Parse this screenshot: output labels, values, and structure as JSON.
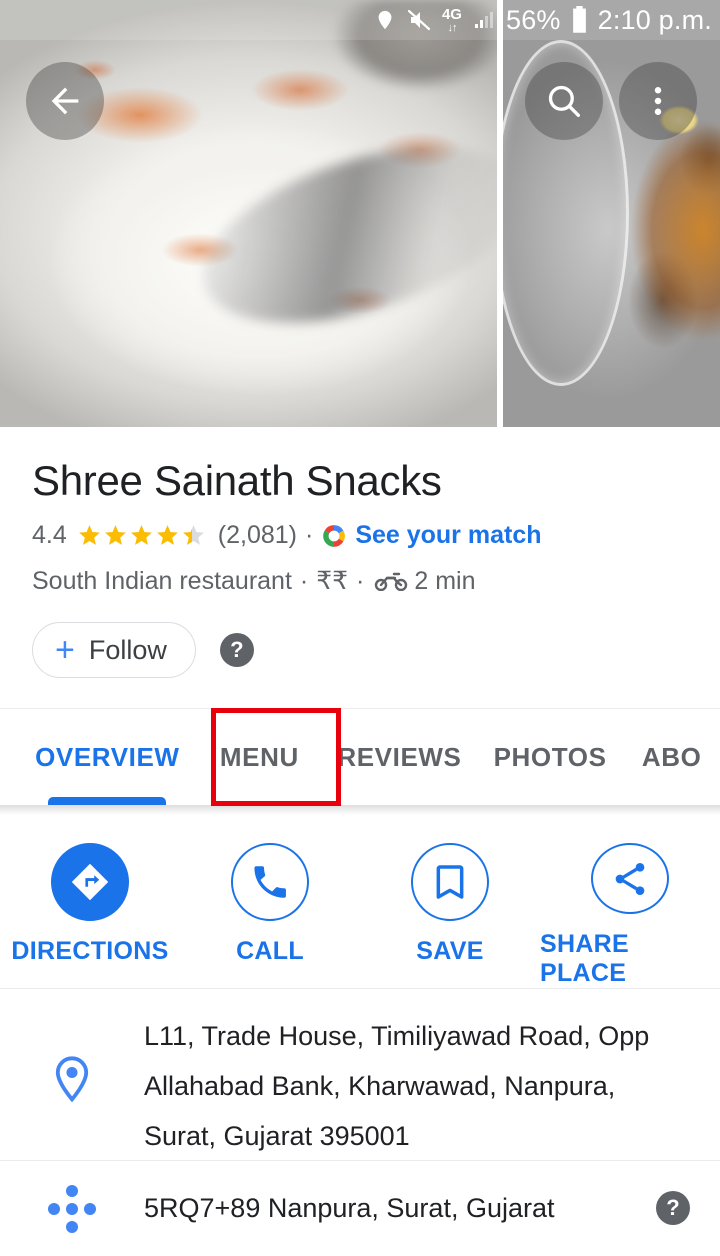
{
  "statusbar": {
    "location_icon": "location-pin-icon",
    "mute_icon": "volume-mute-icon",
    "network_type": "4G",
    "data_arrows": "↓↑",
    "signal_icon": "signal-bars-icon",
    "battery_percent": "56%",
    "battery_icon": "battery-icon",
    "time": "2:10 p.m."
  },
  "photos": {
    "back_icon": "back-arrow-icon",
    "search_icon": "search-icon",
    "more_icon": "more-vert-icon",
    "photo_1_alt": "dahi-dish-photo",
    "photo_2_alt": "butter-dish-photo"
  },
  "place": {
    "title": "Shree Sainath Snacks",
    "rating_value": "4.4",
    "rating_stars": 4.4,
    "review_count": "(2,081)",
    "separator": "·",
    "match_icon": "google-match-donut-icon",
    "match_link": "See your match",
    "category": "South Indian restaurant",
    "price_level": "₹₹",
    "travel_icon": "motorcycle-icon",
    "travel_time": "2 min",
    "follow_label": "Follow",
    "follow_plus": "+",
    "help_label": "?"
  },
  "tabs": {
    "items": [
      {
        "label": "OVERVIEW",
        "active": true
      },
      {
        "label": "MENU",
        "active": false
      },
      {
        "label": "REVIEWS",
        "active": false
      },
      {
        "label": "PHOTOS",
        "active": false
      },
      {
        "label": "ABO",
        "active": false
      }
    ]
  },
  "actions": [
    {
      "label": "DIRECTIONS",
      "icon": "directions-arrow-icon",
      "filled": true
    },
    {
      "label": "CALL",
      "icon": "phone-icon",
      "filled": false
    },
    {
      "label": "SAVE",
      "icon": "bookmark-icon",
      "filled": false
    },
    {
      "label": "SHARE PLACE",
      "icon": "share-icon",
      "filled": false
    }
  ],
  "info": {
    "address_icon": "map-pin-icon",
    "address": "L11, Trade House, Timiliyawad Road, Opp Allahabad Bank, Kharwawad, Nanpura, Surat, Gujarat 395001",
    "pluscode_icon": "plus-code-dots-icon",
    "pluscode": "5RQ7+89 Nanpura, Surat, Gujarat",
    "pluscode_help": "?"
  },
  "highlight": {
    "target": "MENU",
    "color": "#e8000d"
  },
  "colors": {
    "accent_blue": "#1a73e8",
    "star_gold": "#fbbc04",
    "text_primary": "#202124",
    "text_secondary": "#5f6368",
    "highlight_red": "#e8000d"
  }
}
